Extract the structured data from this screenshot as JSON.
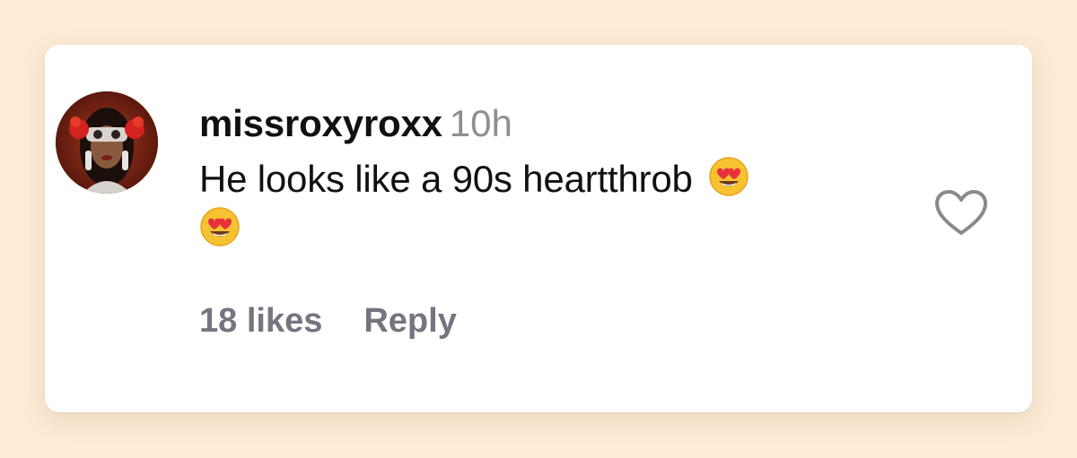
{
  "comment": {
    "username": "missroxyroxx",
    "timestamp": "10h",
    "text": "He looks like a 90s heartthrob",
    "emojis": [
      "heart-eyes-emoji",
      "heart-eyes-emoji"
    ],
    "likes_label": "18 likes",
    "reply_label": "Reply",
    "like_icon": "heart-outline-icon"
  },
  "colors": {
    "background": "#fdebd6",
    "card": "#ffffff",
    "text": "#111111",
    "muted": "#8e8e93",
    "action": "#737680"
  }
}
